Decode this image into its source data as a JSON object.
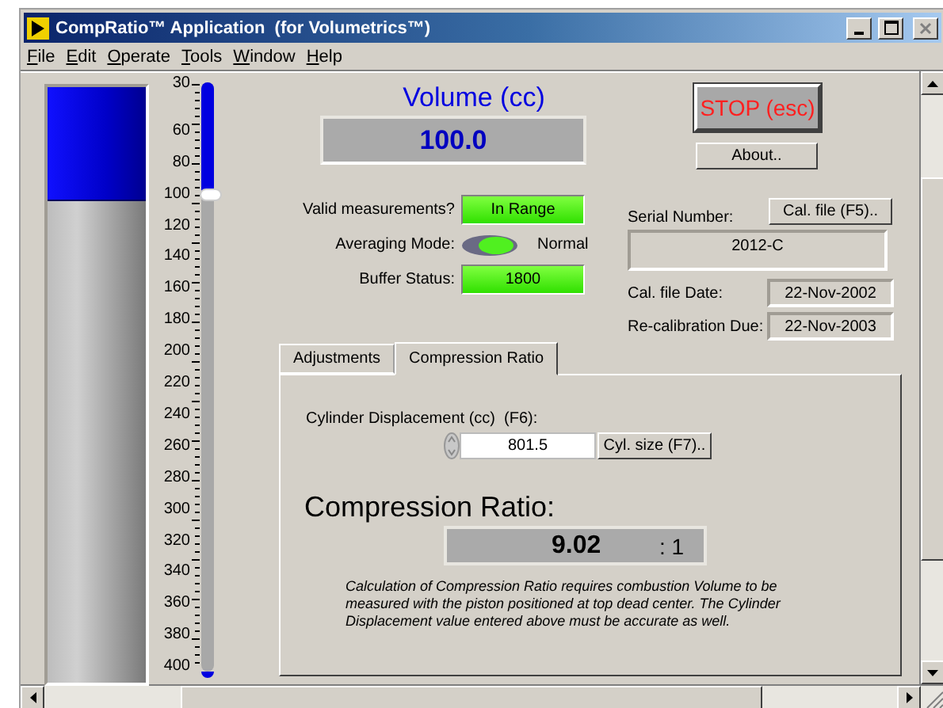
{
  "window": {
    "title": "CompRatio™ Application  (for Volumetrics™)"
  },
  "menu": [
    "File",
    "Edit",
    "Operate",
    "Tools",
    "Window",
    "Help"
  ],
  "tank": {
    "level": 0.19
  },
  "scale": {
    "ticks": [
      "30",
      "60",
      "80",
      "100",
      "120",
      "140",
      "160",
      "180",
      "200",
      "220",
      "240",
      "260",
      "280",
      "300",
      "320",
      "340",
      "360",
      "380",
      "400"
    ]
  },
  "slider": {
    "level": 0.19
  },
  "volume": {
    "label": "Volume (cc)",
    "value": "100.0"
  },
  "stop_button": "STOP (esc)",
  "about_button": "About..",
  "status": [
    {
      "label": "Valid measurements?",
      "kind": "indicator",
      "value": "In Range"
    },
    {
      "label": "Averaging Mode:",
      "kind": "toggle",
      "on": true,
      "value": "Normal"
    },
    {
      "label": "Buffer Status:",
      "kind": "indicator",
      "value": "1800"
    }
  ],
  "calibration": {
    "serial_label": "Serial Number:",
    "cal_button": "Cal. file (F5)..",
    "serial": "2012-C",
    "fields": [
      {
        "label": "Cal. file Date:",
        "value": "22-Nov-2002"
      },
      {
        "label": "Re-calibration Due:",
        "value": "22-Nov-2003"
      }
    ]
  },
  "tabs": [
    {
      "label": "Adjustments",
      "selected": false
    },
    {
      "label": "Compression Ratio",
      "selected": true
    }
  ],
  "compression": {
    "displacement_label": "Cylinder Displacement (cc)  (F6):",
    "displacement": "801.5",
    "size_button": "Cyl. size (F7)..",
    "ratio_label": "Compression Ratio:",
    "ratio": "9.02",
    "ratio_suffix": ": 1",
    "note": "Calculation of Compression Ratio requires combustion Volume to be measured with the piston positioned at top dead center.  The Cylinder Displacement value entered above must be accurate as well."
  }
}
